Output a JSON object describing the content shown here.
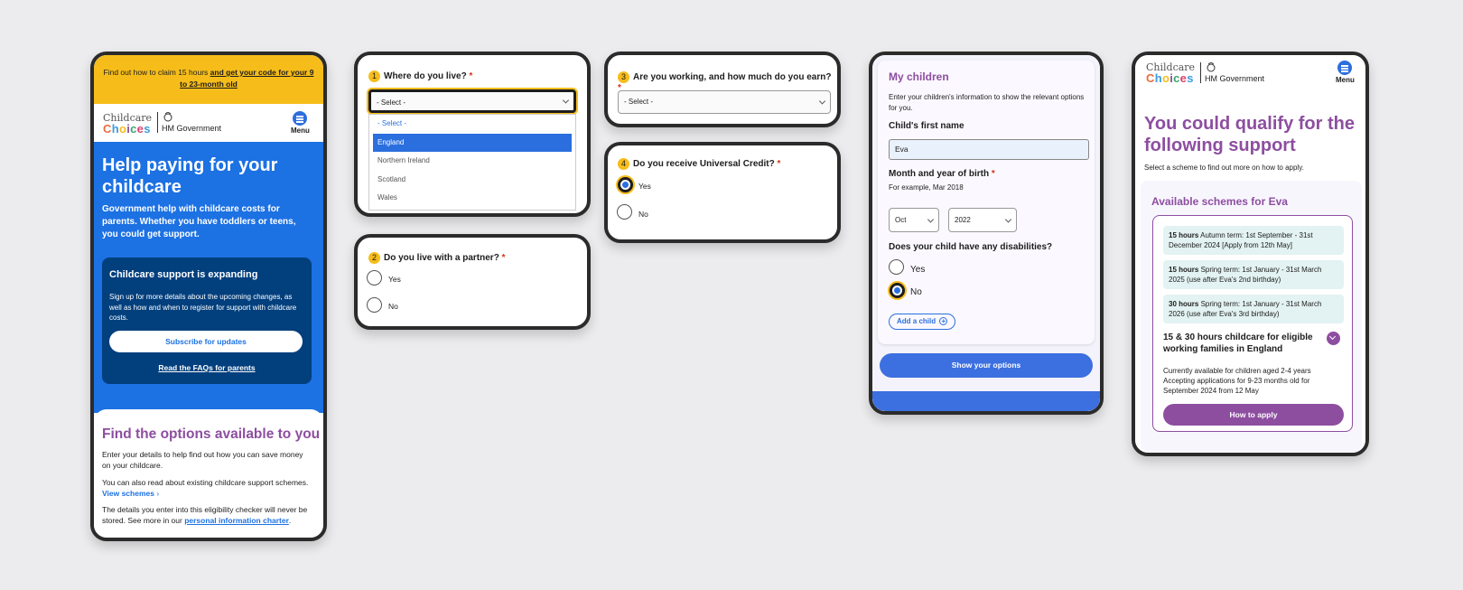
{
  "phone1": {
    "banner_text": "Find out how to claim 15 hours",
    "banner_link": "and get your code for your 9 to 23-month old",
    "logo_line1": "Childcare",
    "logo_line2": "Choices",
    "gov": "HM Government",
    "menu": "Menu",
    "hero_title": "Help paying for your childcare",
    "hero_text": "Government help with childcare costs for parents. Whether you have toddlers or teens, you could get support.",
    "box_title": "Childcare support is expanding",
    "box_text": "Sign up for more details about the upcoming changes, as well as how and when to register for support with childcare costs.",
    "subscribe": "Subscribe for updates",
    "faqs": "Read the FAQs for parents",
    "options_title": "Find the options available to you",
    "options_p1": "Enter your details to help find out how you can save money on your childcare.",
    "options_p2": "You can also read about existing childcare support schemes.",
    "view_schemes": "View schemes",
    "options_p3": "The details you enter into this eligibility checker will never be stored. See more in our",
    "charter_link": "personal information charter",
    "charter_after": "."
  },
  "q1": {
    "num": "1",
    "question": "Where do you live?",
    "req": "*",
    "selected": "- Select -",
    "options": [
      "- Select -",
      "England",
      "Northern Ireland",
      "Scotland",
      "Wales"
    ],
    "highlighted": "England"
  },
  "q2": {
    "num": "2",
    "question": "Do you live with a partner?",
    "req": "*",
    "yes": "Yes",
    "no": "No"
  },
  "q3": {
    "num": "3",
    "question": "Are you working, and how much do you earn?",
    "req": "*",
    "selected": "- Select -"
  },
  "q4": {
    "num": "4",
    "question": "Do you receive Universal Credit?",
    "req": "*",
    "yes": "Yes",
    "no": "No",
    "checked": "Yes"
  },
  "phone4": {
    "title": "My children",
    "intro": "Enter your children's information to show the relevant options for you.",
    "name_label": "Child's first name",
    "name_value": "Eva",
    "birth_label": "Month and year of birth",
    "req": "*",
    "birth_hint": "For example, Mar 2018",
    "month": "Oct",
    "year": "2022",
    "disab_label": "Does your child have any disabilities?",
    "yes": "Yes",
    "no": "No",
    "checked": "No",
    "add_child": "Add a child",
    "show_options": "Show your options"
  },
  "phone5": {
    "logo_line1": "Childcare",
    "logo_line2": "Choices",
    "gov": "HM Government",
    "menu": "Menu",
    "title": "You could qualify for the following support",
    "subtitle": "Select a scheme to find out more on how to apply.",
    "schemes_title": "Available schemes for Eva",
    "schemes": [
      {
        "hours": "15 hours",
        "text": "Autumn term: 1st September - 31st December 2024 [Apply from 12th May]"
      },
      {
        "hours": "15 hours",
        "text": "Spring term: 1st January - 31st March 2025 (use after Eva's 2nd birthday)"
      },
      {
        "hours": "30 hours",
        "text": "Spring term: 1st January - 31st March 2026 (use after Eva's 3rd birthday)"
      }
    ],
    "scheme_heading": "15 & 30 hours childcare for eligible working families in England",
    "scheme_p1": "Currently available for children aged 2-4 years",
    "scheme_p2": "Accepting applications for 9-23 months old for September 2024 from 12 May",
    "how_to_apply": "How to apply"
  }
}
